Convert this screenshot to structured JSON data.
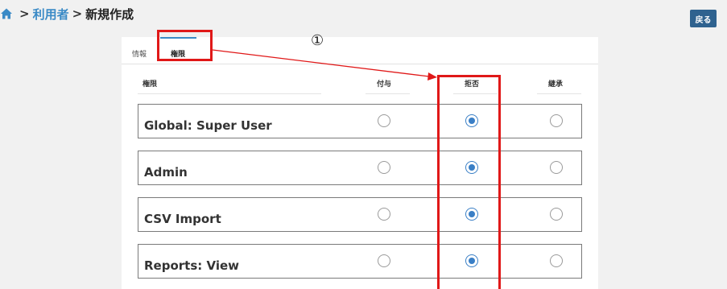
{
  "breadcrumb": {
    "home_icon": "home-icon",
    "items": [
      {
        "label": "利用者"
      },
      {
        "label": "新規作成"
      }
    ],
    "separator": ">"
  },
  "header": {
    "back_label": "戻る"
  },
  "tabs": [
    {
      "label": "情報"
    },
    {
      "label": "権限"
    }
  ],
  "table": {
    "columns": [
      "権限",
      "付与",
      "拒否",
      "継承"
    ],
    "rows": [
      {
        "label": "Global: Super User",
        "selected": "拒否"
      },
      {
        "label": "Admin",
        "selected": "拒否"
      },
      {
        "label": "CSV Import",
        "selected": "拒否"
      },
      {
        "label": "Reports: View",
        "selected": "拒否"
      }
    ]
  },
  "annotation": {
    "marker": "①",
    "color": "#e01818"
  },
  "colors": {
    "accent": "#3a8ac6",
    "back_button": "#2f628f"
  }
}
